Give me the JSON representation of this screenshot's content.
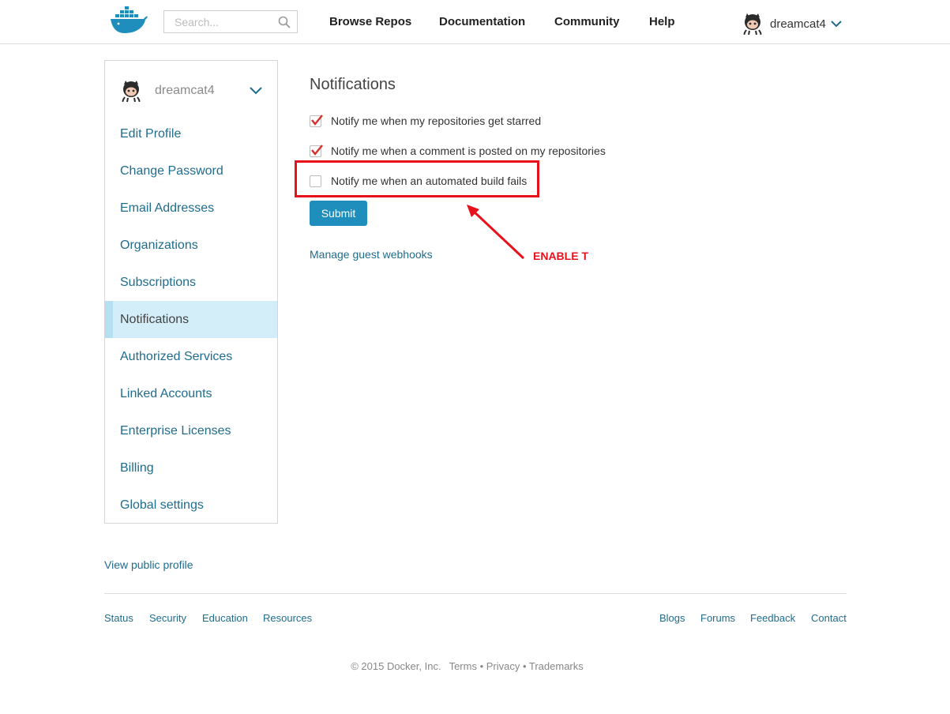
{
  "header": {
    "search_placeholder": "Search...",
    "nav": [
      "Browse Repos",
      "Documentation",
      "Community",
      "Help"
    ],
    "username": "dreamcat4"
  },
  "sidebar": {
    "username": "dreamcat4",
    "items": [
      {
        "label": "Edit Profile",
        "active": false
      },
      {
        "label": "Change Password",
        "active": false
      },
      {
        "label": "Email Addresses",
        "active": false
      },
      {
        "label": "Organizations",
        "active": false
      },
      {
        "label": "Subscriptions",
        "active": false
      },
      {
        "label": "Notifications",
        "active": true
      },
      {
        "label": "Authorized Services",
        "active": false
      },
      {
        "label": "Linked Accounts",
        "active": false
      },
      {
        "label": "Enterprise Licenses",
        "active": false
      },
      {
        "label": "Billing",
        "active": false
      },
      {
        "label": "Global settings",
        "active": false
      }
    ]
  },
  "main": {
    "title": "Notifications",
    "options": [
      {
        "label": "Notify me when my repositories get starred",
        "checked": true
      },
      {
        "label": "Notify me when a comment is posted on my repositories",
        "checked": true
      },
      {
        "label": "Notify me when an automated build fails",
        "checked": false
      }
    ],
    "submit_label": "Submit",
    "webhooks_link": "Manage guest webhooks"
  },
  "annotation": {
    "text": "ENABLE T",
    "color": "#e8111b"
  },
  "footer": {
    "public_profile": "View public profile",
    "left_links": [
      "Status",
      "Security",
      "Education",
      "Resources"
    ],
    "right_links": [
      "Blogs",
      "Forums",
      "Feedback",
      "Contact"
    ],
    "copyright": "© 2015 Docker, Inc.",
    "legal": "Terms • Privacy • Trademarks"
  },
  "colors": {
    "link": "#1f6c8e",
    "button": "#1f8ebd",
    "active_bg": "#d3eef8",
    "logo": "#1f8ebd"
  },
  "icons": {
    "logo": "docker-whale-logo",
    "search": "search-icon",
    "avatar": "octocat-avatar",
    "dropdown": "chevron-down-icon"
  }
}
